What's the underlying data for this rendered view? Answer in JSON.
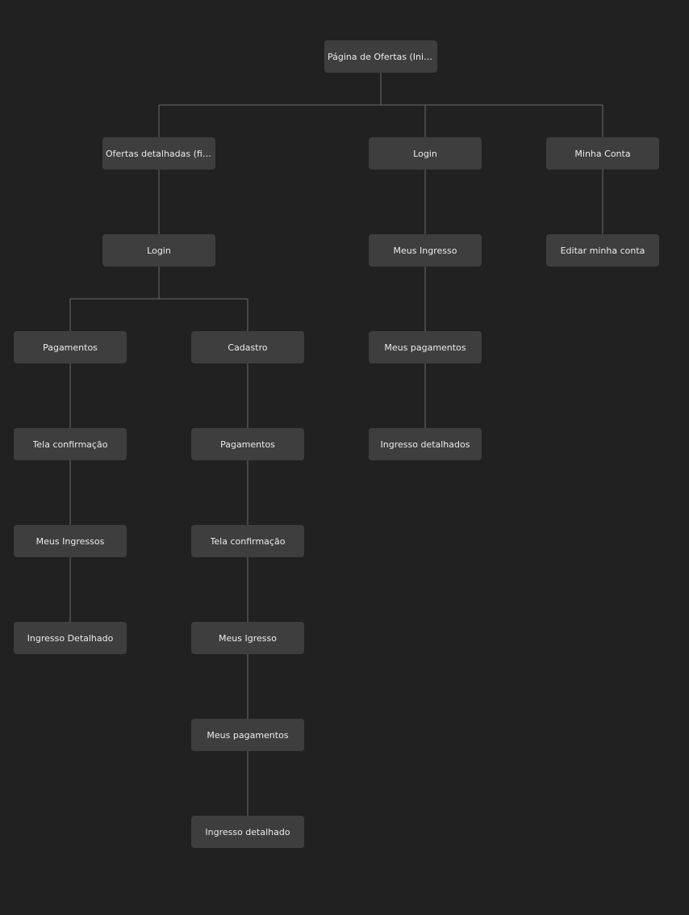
{
  "colors": {
    "background": "#212121",
    "node_fill": "#3e3e3e",
    "node_text": "#ececec",
    "connector": "#6b6b6b"
  },
  "nodes": [
    {
      "id": "root",
      "label": "Página de Ofertas (Inicial)"
    },
    {
      "id": "ofertas-detalhadas",
      "label": "Ofertas detalhadas (filmes)",
      "parent": "root"
    },
    {
      "id": "login-a",
      "label": "Login",
      "parent": "ofertas-detalhadas"
    },
    {
      "id": "pagamentos-a",
      "label": "Pagamentos",
      "parent": "login-a"
    },
    {
      "id": "tela-confirmacao-a",
      "label": "Tela confirmação",
      "parent": "pagamentos-a"
    },
    {
      "id": "meus-ingressos-a",
      "label": "Meus Ingressos",
      "parent": "tela-confirmacao-a"
    },
    {
      "id": "ingresso-detalhado-a",
      "label": "Ingresso Detalhado",
      "parent": "meus-ingressos-a"
    },
    {
      "id": "cadastro",
      "label": "Cadastro",
      "parent": "login-a"
    },
    {
      "id": "pagamentos-b",
      "label": "Pagamentos",
      "parent": "cadastro"
    },
    {
      "id": "tela-confirmacao-b",
      "label": "Tela confirmação",
      "parent": "pagamentos-b"
    },
    {
      "id": "meus-igresso-b",
      "label": "Meus Igresso",
      "parent": "tela-confirmacao-b"
    },
    {
      "id": "meus-pagamentos-b",
      "label": "Meus pagamentos",
      "parent": "meus-igresso-b"
    },
    {
      "id": "ingresso-detalhado-b",
      "label": "Ingresso detalhado",
      "parent": "meus-pagamentos-b"
    },
    {
      "id": "login-c",
      "label": "Login",
      "parent": "root"
    },
    {
      "id": "meus-ingresso-c",
      "label": "Meus Ingresso",
      "parent": "login-c"
    },
    {
      "id": "meus-pagamentos-c",
      "label": "Meus pagamentos",
      "parent": "meus-ingresso-c"
    },
    {
      "id": "ingresso-detalhados-c",
      "label": "Ingresso detalhados",
      "parent": "meus-pagamentos-c"
    },
    {
      "id": "minha-conta",
      "label": "Minha Conta",
      "parent": "root"
    },
    {
      "id": "editar-minha-conta",
      "label": "Editar minha conta",
      "parent": "minha-conta"
    }
  ]
}
